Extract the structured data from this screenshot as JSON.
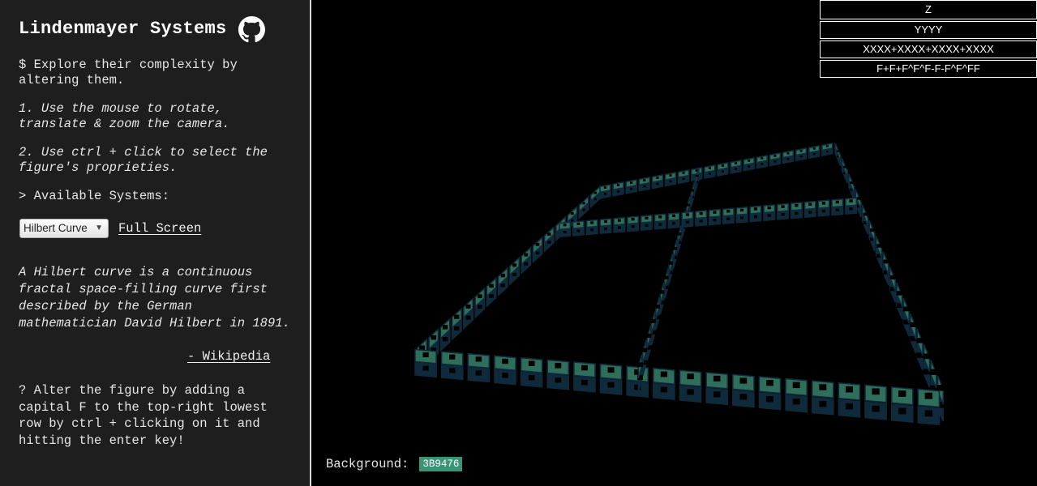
{
  "sidebar": {
    "title": "Lindenmayer Systems",
    "github_icon": "github-icon",
    "intro": "$ Explore their complexity by altering them.",
    "instruction_1": "1. Use the mouse to rotate, translate & zoom the camera.",
    "instruction_2": "2. Use ctrl + click to select the figure's proprieties.",
    "available_label": "> Available Systems:",
    "system_select": {
      "selected": "Hilbert Curve"
    },
    "fullscreen_label": "Full Screen",
    "description": "A Hilbert curve is a continuous fractal space-filling curve first described by the German mathematician David Hilbert in 1891.",
    "wiki_link": "- Wikipedia",
    "hint": "? Alter the figure by adding a capital F to the top-right lowest row by ctrl + clicking on it and hitting the enter key!"
  },
  "rules": [
    "Z",
    "YYYY",
    "XXXX+XXXX+XXXX+XXXX",
    "F+F+F^F^F-F-F^F^FF"
  ],
  "background": {
    "label": "Background:",
    "value": "3B9476"
  },
  "colors": {
    "figure": "#2e6e5a",
    "figure_shadow": "#0f2a3a",
    "accent": "#3b9476",
    "sidebar_bg": "#1e1e1e"
  }
}
